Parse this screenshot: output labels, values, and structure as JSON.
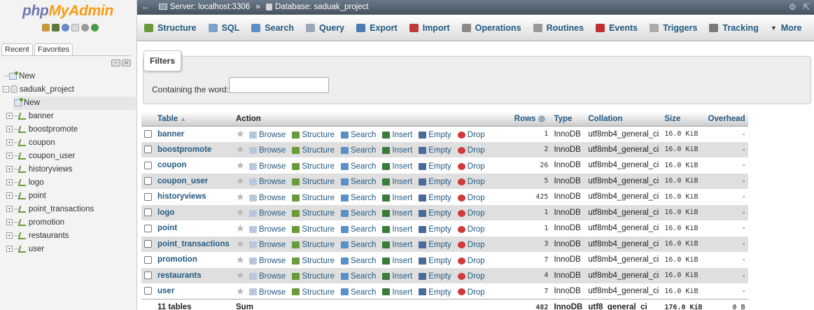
{
  "nav": {
    "logo_main": "php",
    "logo_accent": "MyAdmin",
    "tab_recent": "Recent",
    "tab_favorites": "Favorites",
    "new_root": "New",
    "database": "saduak_project",
    "new_table": "New",
    "tables": [
      "banner",
      "boostpromote",
      "coupon",
      "coupon_user",
      "historyviews",
      "logo",
      "point",
      "point_transactions",
      "promotion",
      "restaurants",
      "user"
    ]
  },
  "topbar": {
    "server": "Server: localhost:3306",
    "separator": "»",
    "database": "Database: saduak_project"
  },
  "tabs": [
    {
      "label": "Structure",
      "icon": "structure-icon",
      "color": "#6a9a3c"
    },
    {
      "label": "SQL",
      "icon": "sql-icon",
      "color": "#7fa0c8"
    },
    {
      "label": "Search",
      "icon": "search-icon",
      "color": "#5a8fc8"
    },
    {
      "label": "Query",
      "icon": "query-icon",
      "color": "#9aa8b8"
    },
    {
      "label": "Export",
      "icon": "export-icon",
      "color": "#4a7ab0"
    },
    {
      "label": "Import",
      "icon": "import-icon",
      "color": "#c03a3a"
    },
    {
      "label": "Operations",
      "icon": "wrench-icon",
      "color": "#8a8a8a"
    },
    {
      "label": "Routines",
      "icon": "routines-icon",
      "color": "#999999"
    },
    {
      "label": "Events",
      "icon": "clock-icon",
      "color": "#c03030"
    },
    {
      "label": "Triggers",
      "icon": "triggers-icon",
      "color": "#aaaaaa"
    },
    {
      "label": "Tracking",
      "icon": "eye-icon",
      "color": "#7a7a7a"
    },
    {
      "label": "More",
      "icon": "caret-down-icon",
      "color": "#333333"
    }
  ],
  "filters": {
    "legend": "Filters",
    "label": "Containing the word:",
    "value": ""
  },
  "table": {
    "headers": {
      "table": "Table",
      "action": "Action",
      "rows": "Rows",
      "type": "Type",
      "collation": "Collation",
      "size": "Size",
      "overhead": "Overhead"
    },
    "actions": [
      "Browse",
      "Structure",
      "Search",
      "Insert",
      "Empty",
      "Drop"
    ],
    "rows": [
      {
        "name": "banner",
        "rows": "1",
        "type": "InnoDB",
        "collation": "utf8mb4_general_ci",
        "size": "16.0 KiB",
        "overhead": "-"
      },
      {
        "name": "boostpromote",
        "rows": "2",
        "type": "InnoDB",
        "collation": "utf8mb4_general_ci",
        "size": "16.0 KiB",
        "overhead": "-"
      },
      {
        "name": "coupon",
        "rows": "26",
        "type": "InnoDB",
        "collation": "utf8mb4_general_ci",
        "size": "16.0 KiB",
        "overhead": "-"
      },
      {
        "name": "coupon_user",
        "rows": "5",
        "type": "InnoDB",
        "collation": "utf8mb4_general_ci",
        "size": "16.0 KiB",
        "overhead": "-"
      },
      {
        "name": "historyviews",
        "rows": "425",
        "type": "InnoDB",
        "collation": "utf8mb4_general_ci",
        "size": "16.0 KiB",
        "overhead": "-"
      },
      {
        "name": "logo",
        "rows": "1",
        "type": "InnoDB",
        "collation": "utf8mb4_general_ci",
        "size": "16.0 KiB",
        "overhead": "-"
      },
      {
        "name": "point",
        "rows": "1",
        "type": "InnoDB",
        "collation": "utf8mb4_general_ci",
        "size": "16.0 KiB",
        "overhead": "-"
      },
      {
        "name": "point_transactions",
        "rows": "3",
        "type": "InnoDB",
        "collation": "utf8mb4_general_ci",
        "size": "16.0 KiB",
        "overhead": "-"
      },
      {
        "name": "promotion",
        "rows": "7",
        "type": "InnoDB",
        "collation": "utf8mb4_general_ci",
        "size": "16.0 KiB",
        "overhead": "-"
      },
      {
        "name": "restaurants",
        "rows": "4",
        "type": "InnoDB",
        "collation": "utf8mb4_general_ci",
        "size": "16.0 KiB",
        "overhead": "-"
      },
      {
        "name": "user",
        "rows": "7",
        "type": "InnoDB",
        "collation": "utf8mb4_general_ci",
        "size": "16.0 KiB",
        "overhead": "-"
      }
    ],
    "footer": {
      "count": "11 tables",
      "sum": "Sum",
      "rows": "482",
      "type": "InnoDB",
      "collation": "utf8_general_ci",
      "size": "176.0 KiB",
      "overhead": "0 B"
    }
  }
}
